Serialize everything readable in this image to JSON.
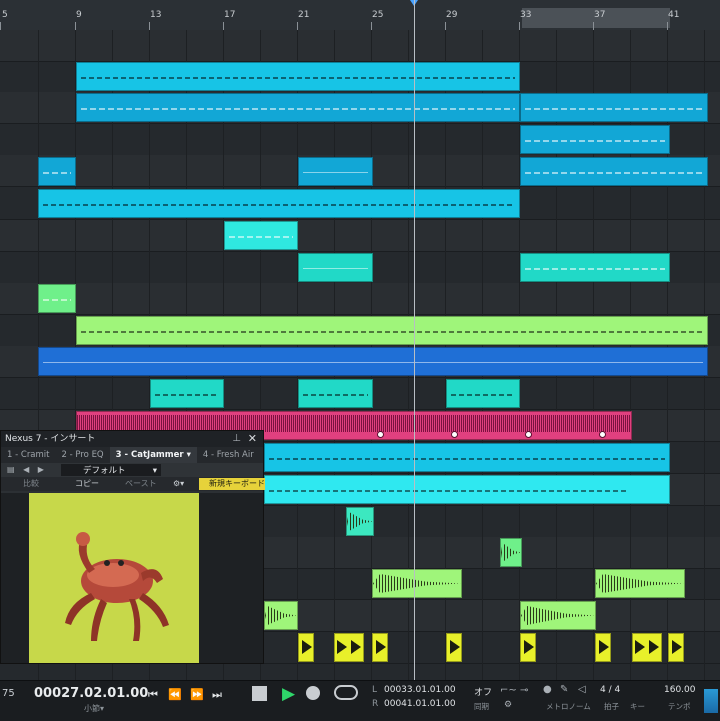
{
  "ruler": {
    "bars": [
      "5",
      "9",
      "13",
      "17",
      "21",
      "25",
      "29",
      "33",
      "37",
      "41"
    ]
  },
  "plugin": {
    "title": "Nexus 7 - インサート",
    "pin_icon": "pin-icon",
    "close_label": "✕",
    "tabs": [
      "1 - Cramit",
      "2 - Pro EQ",
      "3 - CatJammer ▾",
      "4 - Fresh Air"
    ],
    "active_tab": 2,
    "preset": "デフォルト",
    "compare": "比較",
    "copy": "コピー",
    "paste": "ペースト",
    "new_keyboard": "新規キーボード"
  },
  "transport": {
    "left_value": "75",
    "position": "00027.02.01.00",
    "position_unit": "小節▾",
    "loop_L_label": "L",
    "loop_L": "00033.01.01.00",
    "loop_R_label": "R",
    "loop_R": "00041.01.01.00",
    "sync_value": "オフ",
    "sync_label": "同期",
    "metronome_label": "メトロノーム",
    "time_sig": "4 / 4",
    "time_sig_label": "拍子",
    "key_label": "キー",
    "tempo": "160.00",
    "tempo_label": "テンポ"
  },
  "colors": {
    "cyan": "#17c4e6",
    "cyan_dark": "#12a7d6",
    "aqua": "#21d9c7",
    "mint": "#2ff0b2",
    "lightgreen": "#6ff08a",
    "lime": "#9ff57a",
    "blue": "#1f6fd6",
    "pink": "#e0407f",
    "yellow": "#e8f02a"
  }
}
